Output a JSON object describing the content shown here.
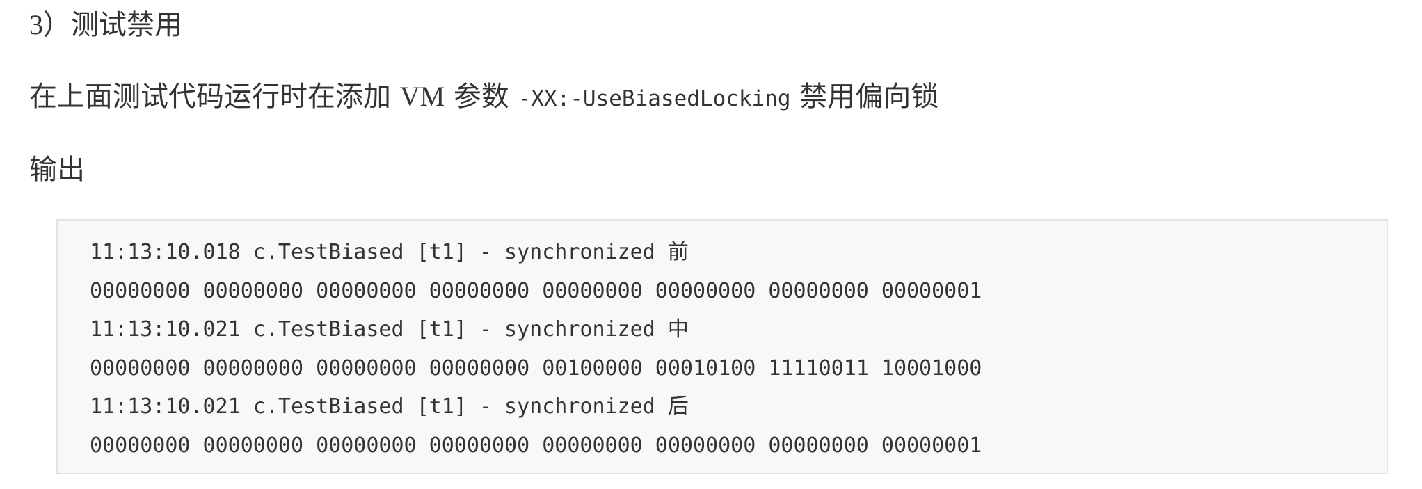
{
  "section": {
    "number": "3）",
    "title": "测试禁用"
  },
  "paragraph": {
    "text_before": "在上面测试代码运行时在添加 ",
    "vm": "VM",
    "text_middle": " 参数 ",
    "option_code": "-XX:-UseBiasedLocking",
    "text_after": " 禁用偏向锁"
  },
  "output_label": "输出",
  "code_output": {
    "lines": [
      "11:13:10.018 c.TestBiased [t1] - synchronized 前",
      "00000000 00000000 00000000 00000000 00000000 00000000 00000000 00000001",
      "11:13:10.021 c.TestBiased [t1] - synchronized 中",
      "00000000 00000000 00000000 00000000 00100000 00010100 11110011 10001000",
      "11:13:10.021 c.TestBiased [t1] - synchronized 后",
      "00000000 00000000 00000000 00000000 00000000 00000000 00000000 00000001"
    ]
  }
}
